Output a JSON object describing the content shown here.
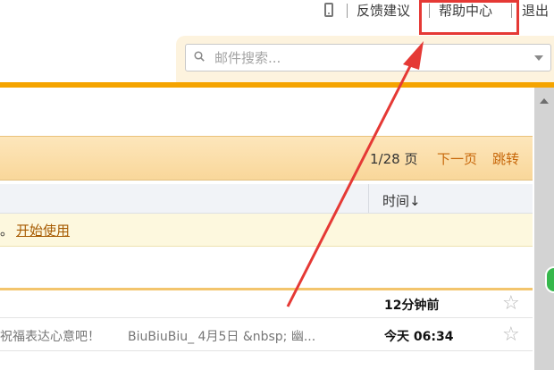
{
  "toplinks": {
    "feedback": "反馈建议",
    "help": "帮助中心",
    "logout": "退出"
  },
  "search": {
    "placeholder": "邮件搜索..."
  },
  "pager": {
    "indicator": "1/28 页",
    "next": "下一页",
    "jump": "跳转"
  },
  "columns": {
    "time": "时间↓"
  },
  "notice": {
    "prefix": "。",
    "link": "开始使用"
  },
  "emails": [
    {
      "subject": "",
      "snippet": "",
      "time": "12分钟前",
      "star": "☆"
    },
    {
      "subject": "祝福表达心意吧！",
      "snippet": "BiuBiuBiu_ 4月5日 &nbsp; 幽...",
      "time": "今天 06:34",
      "star": "☆"
    }
  ],
  "annotation_color": "#e53935",
  "accent_color": "#f5a400"
}
